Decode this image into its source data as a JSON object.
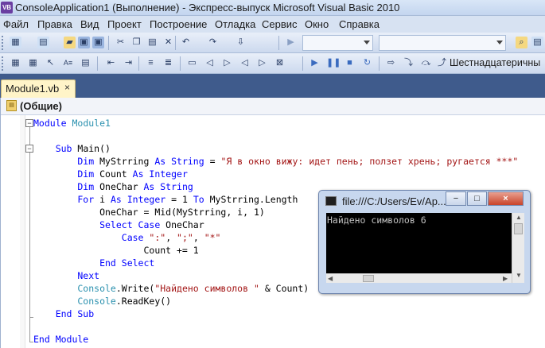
{
  "window": {
    "title": "ConsoleApplication1 (Выполнение) - Экспресс-выпуск Microsoft Visual Basic 2010",
    "icon": "vb-icon"
  },
  "menu": [
    "Файл",
    "Правка",
    "Вид",
    "Проект",
    "Построение",
    "Отладка",
    "Сервис",
    "Окно",
    "Справка"
  ],
  "toolbar2": {
    "display_format": "Шестнадцатеричны"
  },
  "tab": {
    "label": "Module1.vb",
    "close": "×"
  },
  "navbar": {
    "label": "(Общие)"
  },
  "code_lines": [
    [
      {
        "t": "Module ",
        "c": "kw"
      },
      {
        "t": "Module1",
        "c": "ty"
      }
    ],
    [],
    [
      {
        "t": "    Sub ",
        "c": "kw"
      },
      {
        "t": "Main()",
        "c": ""
      }
    ],
    [
      {
        "t": "        Dim ",
        "c": "kw"
      },
      {
        "t": "MyStrring ",
        "c": ""
      },
      {
        "t": "As String ",
        "c": "kw"
      },
      {
        "t": "= ",
        "c": ""
      },
      {
        "t": "\"Я в окно вижу: идет пень; ползет хрень; ругается ***\"",
        "c": "str"
      }
    ],
    [
      {
        "t": "        Dim ",
        "c": "kw"
      },
      {
        "t": "Count ",
        "c": ""
      },
      {
        "t": "As Integer",
        "c": "kw"
      }
    ],
    [
      {
        "t": "        Dim ",
        "c": "kw"
      },
      {
        "t": "OneChar ",
        "c": ""
      },
      {
        "t": "As String",
        "c": "kw"
      }
    ],
    [
      {
        "t": "        For ",
        "c": "kw"
      },
      {
        "t": "i ",
        "c": ""
      },
      {
        "t": "As Integer ",
        "c": "kw"
      },
      {
        "t": "= 1 ",
        "c": ""
      },
      {
        "t": "To ",
        "c": "kw"
      },
      {
        "t": "MyStrring.Length",
        "c": ""
      }
    ],
    [
      {
        "t": "            OneChar = Mid(MyStrring, i, 1)",
        "c": ""
      }
    ],
    [
      {
        "t": "            Select Case ",
        "c": "kw"
      },
      {
        "t": "OneChar",
        "c": ""
      }
    ],
    [
      {
        "t": "                Case ",
        "c": "kw"
      },
      {
        "t": "\":\"",
        "c": "str"
      },
      {
        "t": ", ",
        "c": ""
      },
      {
        "t": "\";\"",
        "c": "str"
      },
      {
        "t": ", ",
        "c": ""
      },
      {
        "t": "\"*\"",
        "c": "str"
      }
    ],
    [
      {
        "t": "                    Count += 1",
        "c": ""
      }
    ],
    [
      {
        "t": "            End Select",
        "c": "kw"
      }
    ],
    [
      {
        "t": "        Next",
        "c": "kw"
      }
    ],
    [
      {
        "t": "        Console",
        "c": "ty"
      },
      {
        "t": ".Write(",
        "c": ""
      },
      {
        "t": "\"Найдено символов \"",
        "c": "str"
      },
      {
        "t": " & Count)",
        "c": ""
      }
    ],
    [
      {
        "t": "        Console",
        "c": "ty"
      },
      {
        "t": ".ReadKey()",
        "c": ""
      }
    ],
    [
      {
        "t": "    End Sub",
        "c": "kw"
      }
    ],
    [],
    [
      {
        "t": "End Module",
        "c": "kw"
      }
    ]
  ],
  "console": {
    "title": "file:///C:/Users/Ev/Ap...",
    "output": "Найдено символов 6",
    "minimize": "−",
    "maximize": "□",
    "close": "×"
  }
}
